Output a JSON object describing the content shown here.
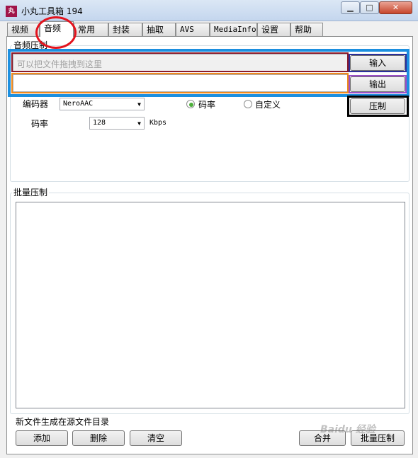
{
  "window": {
    "title": "小丸工具箱 194",
    "icon_text": "丸"
  },
  "window_controls": {
    "minimize": "▁",
    "maximize": "□",
    "close": "✕"
  },
  "tabs": [
    {
      "label": "视频"
    },
    {
      "label": "音频"
    },
    {
      "label": "常用"
    },
    {
      "label": "封装"
    },
    {
      "label": "抽取"
    },
    {
      "label": "AVS"
    },
    {
      "label": "MediaInfo"
    },
    {
      "label": "设置"
    },
    {
      "label": "帮助"
    }
  ],
  "audio_compress": {
    "group_label": "音频压制",
    "input_placeholder": "可以把文件拖拽到这里",
    "output_value": "",
    "input_button": "输入",
    "output_button": "输出",
    "compress_button": "压制",
    "encoder_label": "编码器",
    "encoder_value": "NeroAAC",
    "radio_bitrate": "码率",
    "radio_custom": "自定义",
    "bitrate_label": "码率",
    "bitrate_value": "128",
    "bitrate_unit": "Kbps"
  },
  "batch": {
    "group_label": "批量压制",
    "note": "新文件生成在源文件目录",
    "add_button": "添加",
    "delete_button": "删除",
    "clear_button": "清空",
    "merge_button": "合并",
    "batch_button": "批量压制"
  },
  "watermark": "Baidu 经验",
  "annotation_colors": {
    "tab_circle": "#e3141e",
    "blue": "#1b8fe0",
    "dark_red": "#8b1a2a",
    "orange": "#f08a1c",
    "navy": "#2a2f9a",
    "purple": "#9b4fc8",
    "black": "#000000"
  }
}
